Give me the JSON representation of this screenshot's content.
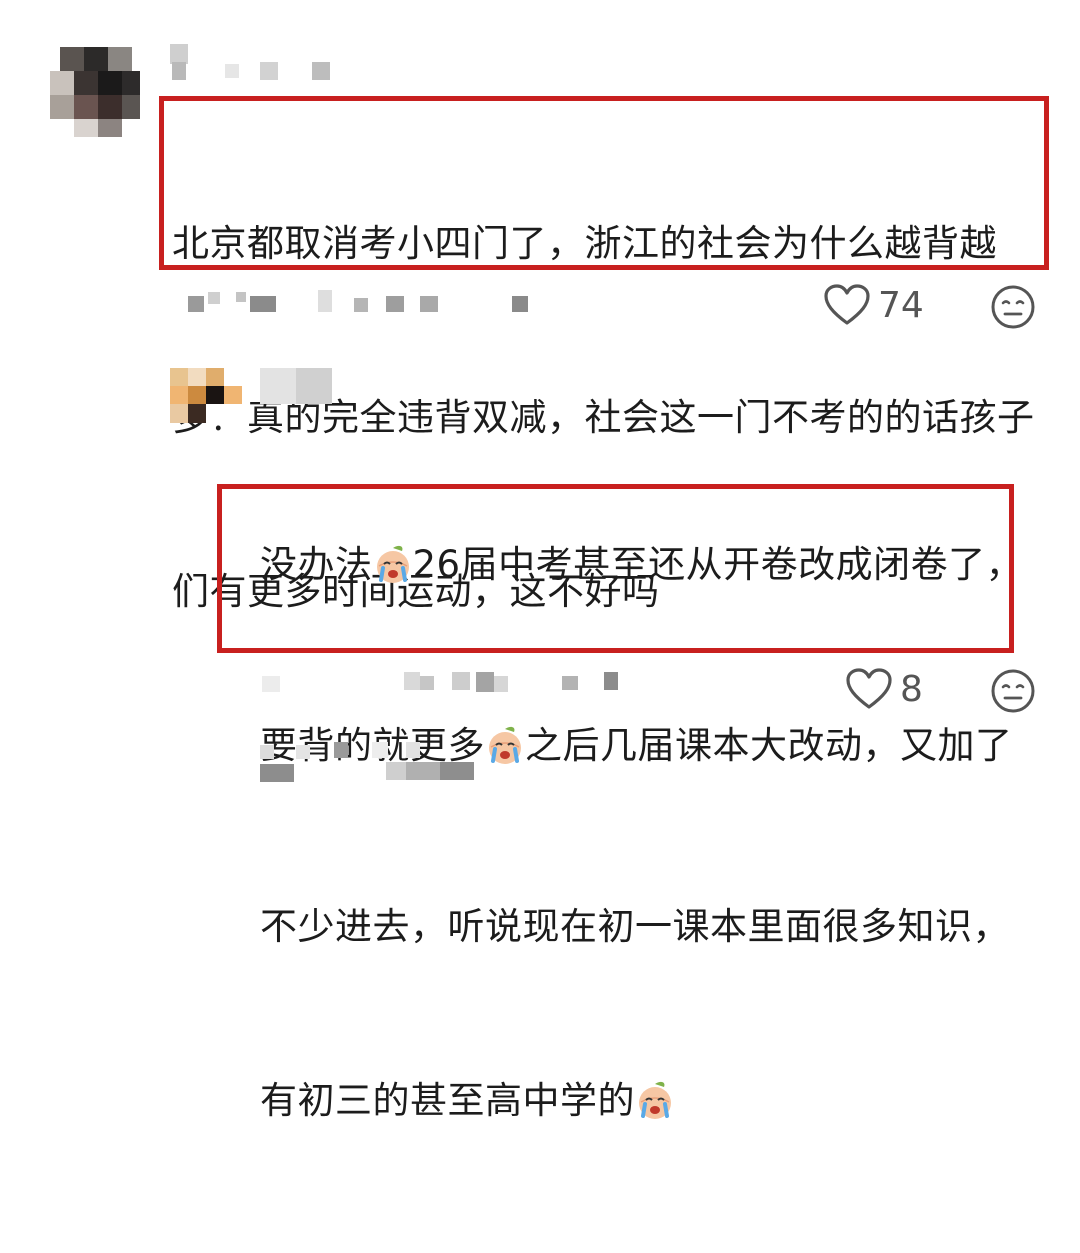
{
  "comments": [
    {
      "text_lines": [
        "北京都取消考小四门了，浙江的社会为什么越背越",
        "多？真的完全违背双减，社会这一门不考的的话孩子",
        "们有更多时间运动，这不好吗"
      ],
      "like_count": "74"
    },
    {
      "text_line_1_a": "没办法",
      "text_line_1_b": "26届中考甚至还从开卷改成闭卷了，",
      "text_line_2_a": "要背的就更多",
      "text_line_2_b": "之后几届课本大改动，又加了",
      "text_line_3": "不少进去，听说现在初一课本里面很多知识，",
      "text_line_4": "有初三的甚至高中学的",
      "like_count": "8"
    }
  ],
  "icons": {
    "like": "heart-outline-icon",
    "reaction": "neutral-face-icon",
    "emoji": "crying-peach-emoji"
  },
  "colors": {
    "highlight": "#c8201f",
    "text": "#1c1c1c",
    "meta": "#555555"
  }
}
